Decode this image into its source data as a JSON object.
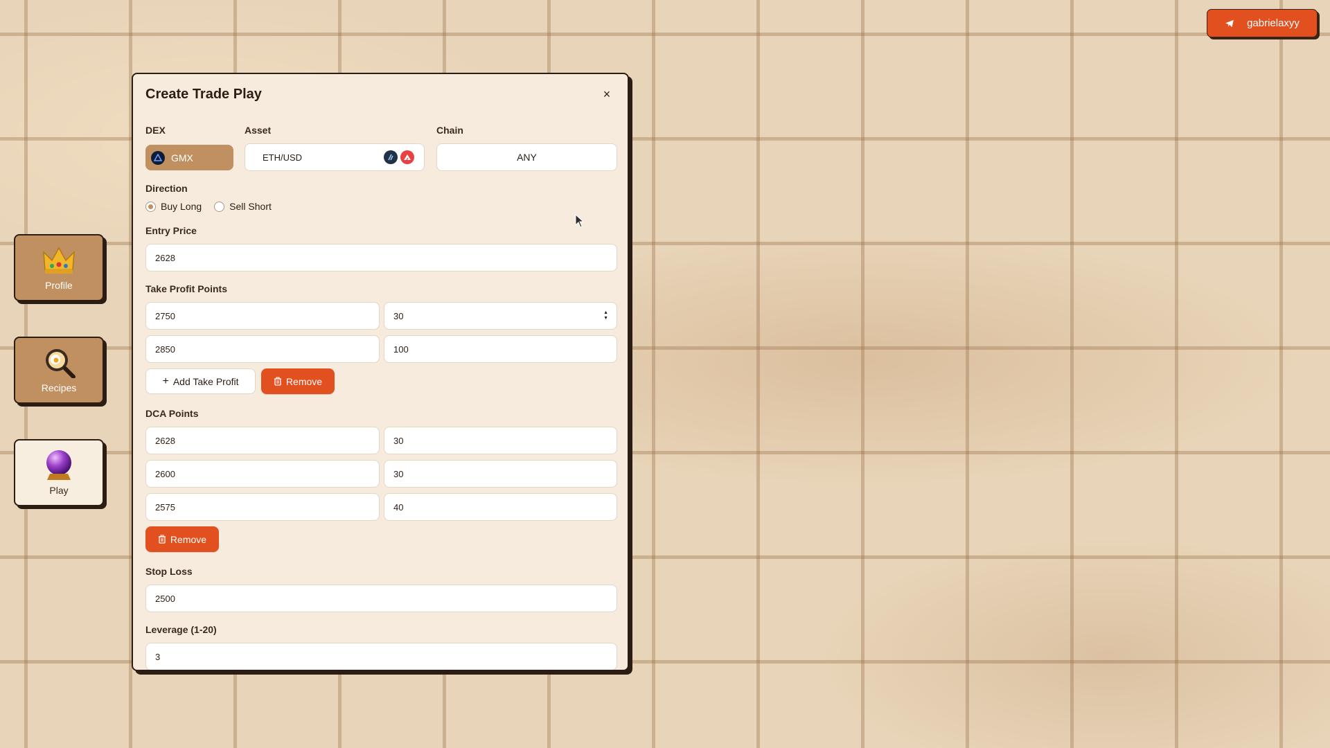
{
  "user": {
    "name": "gabrielaxyy",
    "icon": "telegram-send-icon"
  },
  "nav": [
    {
      "label": "Profile",
      "icon": "crown-icon",
      "active": false
    },
    {
      "label": "Recipes",
      "icon": "magnifier-cooking-icon",
      "active": false
    },
    {
      "label": "Play",
      "icon": "crystal-ball-icon",
      "active": true
    }
  ],
  "modal": {
    "title": "Create Trade Play",
    "close_glyph": "×",
    "dex": {
      "label": "DEX",
      "value": "GMX"
    },
    "asset": {
      "label": "Asset",
      "value": "ETH/USD",
      "icons": [
        "arbitrum-icon",
        "avalanche-icon"
      ]
    },
    "chain": {
      "label": "Chain",
      "value": "ANY"
    },
    "direction": {
      "label": "Direction",
      "options": [
        "Buy Long",
        "Sell Short"
      ],
      "selected": "Buy Long"
    },
    "entry_price": {
      "label": "Entry Price",
      "value": "2628"
    },
    "take_profit": {
      "label": "Take Profit Points",
      "rows": [
        {
          "price": "2750",
          "percent": "30"
        },
        {
          "price": "2850",
          "percent": "100"
        }
      ],
      "add_label": "Add Take Profit",
      "remove_label": "Remove"
    },
    "dca": {
      "label": "DCA Points",
      "rows": [
        {
          "price": "2628",
          "percent": "30"
        },
        {
          "price": "2600",
          "percent": "30"
        },
        {
          "price": "2575",
          "percent": "40"
        }
      ],
      "remove_label": "Remove"
    },
    "stop_loss": {
      "label": "Stop Loss",
      "value": "2500"
    },
    "leverage": {
      "label": "Leverage (1-20)",
      "value": "3"
    }
  },
  "colors": {
    "accent": "#e2501f",
    "tan": "#c09060",
    "panel": "#f6ebdc",
    "ink": "#2c1d14"
  }
}
